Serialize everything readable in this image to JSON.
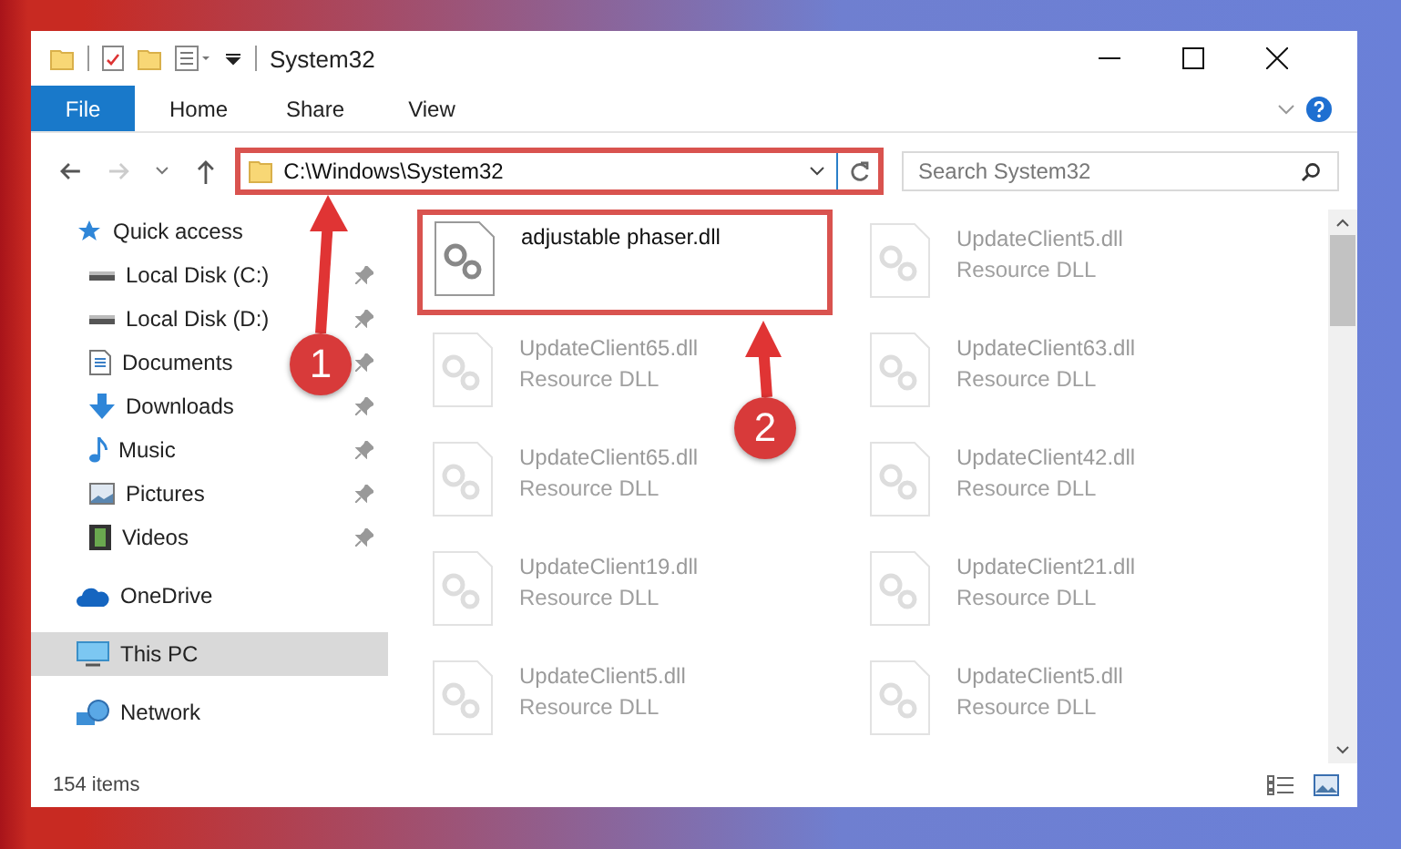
{
  "window": {
    "title": "System32"
  },
  "ribbon_tabs": [
    {
      "label": "File",
      "selected": true
    },
    {
      "label": "Home",
      "selected": false
    },
    {
      "label": "Share",
      "selected": false
    },
    {
      "label": "View",
      "selected": false
    }
  ],
  "address": {
    "path": "C:\\Windows\\System32"
  },
  "search": {
    "placeholder": "Search System32"
  },
  "sidebar": {
    "items": [
      {
        "label": "Quick access",
        "kind": "star",
        "selected": false,
        "children": [
          {
            "label": "Local Disk (C:)",
            "kind": "disk",
            "selected": false,
            "pinned": true
          },
          {
            "label": "Local Disk (D:)",
            "kind": "disk",
            "selected": false,
            "pinned": true
          },
          {
            "label": "Documents",
            "kind": "doc",
            "selected": false,
            "pinned": true
          },
          {
            "label": "Downloads",
            "kind": "download",
            "selected": false,
            "pinned": true
          },
          {
            "label": "Music",
            "kind": "music",
            "selected": false,
            "pinned": true
          },
          {
            "label": "Pictures",
            "kind": "picture",
            "selected": false,
            "pinned": true
          },
          {
            "label": "Videos",
            "kind": "video",
            "selected": false,
            "pinned": true
          }
        ]
      },
      {
        "label": "OneDrive",
        "kind": "cloud",
        "selected": false
      },
      {
        "label": "This PC",
        "kind": "pc",
        "selected": true
      },
      {
        "label": "Network",
        "kind": "network",
        "selected": false
      }
    ]
  },
  "files": [
    {
      "name": "adjustable phaser.dll",
      "highlighted": true
    },
    {
      "name": "UpdateClient5.dll",
      "type": "Resource DLL",
      "highlighted": false
    },
    {
      "name": "UpdateClient65.dll",
      "type": "Resource DLL",
      "highlighted": false
    },
    {
      "name": "UpdateClient63.dll",
      "type": "Resource DLL",
      "highlighted": false
    },
    {
      "name": "UpdateClient65.dll",
      "type": "Resource DLL",
      "highlighted": false
    },
    {
      "name": "UpdateClient42.dll",
      "type": "Resource DLL",
      "highlighted": false
    },
    {
      "name": "UpdateClient19.dll",
      "type": "Resource DLL",
      "highlighted": false
    },
    {
      "name": "UpdateClient21.dll",
      "type": "Resource DLL",
      "highlighted": false
    },
    {
      "name": "UpdateClient5.dll",
      "type": "Resource DLL",
      "highlighted": false
    },
    {
      "name": "UpdateClient5.dll",
      "type": "Resource DLL",
      "highlighted": false
    }
  ],
  "status_bar": {
    "count": "154 items"
  },
  "annotations": [
    {
      "number": "1"
    },
    {
      "number": "2"
    }
  ]
}
